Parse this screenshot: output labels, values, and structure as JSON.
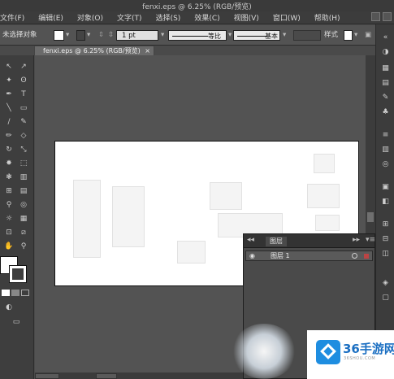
{
  "window": {
    "title": "fenxi.eps @ 6.25% (RGB/预览)"
  },
  "menu": [
    "文件(F)",
    "编辑(E)",
    "对象(O)",
    "文字(T)",
    "选择(S)",
    "效果(C)",
    "视图(V)",
    "窗口(W)",
    "帮助(H)"
  ],
  "control_bar": {
    "selection_label": "未选择对象",
    "stroke_weight": "1 pt",
    "stroke_profile": "等比",
    "brush_profile": "基本",
    "style_label": "样式"
  },
  "document_tab": {
    "label": "fenxi.eps @ 6.25% (RGB/预览)",
    "close": "×"
  },
  "tools": {
    "selection": "↖",
    "direct_selection": "↗",
    "magic_wand": "✦",
    "lasso": "ʘ",
    "pen": "✒",
    "type": "T",
    "line": "╲",
    "rectangle": "▭",
    "paintbrush": "∕",
    "pencil": "✎",
    "blob": "✏",
    "eraser": "◇",
    "rotate": "↻",
    "scale": "⤡",
    "warp": "✸",
    "free_transform": "⬚",
    "symbol_sprayer": "❃",
    "graph": "▥",
    "mesh": "⊞",
    "gradient": "▤",
    "eyedropper": "⚲",
    "blend": "◎",
    "symbol": "☼",
    "column_graph": "▦",
    "artboard": "⊡",
    "slice": "⧄",
    "hand": "✋",
    "zoom": "⚲"
  },
  "layers_panel": {
    "tab_label": "图层",
    "rows": [
      {
        "eye": "◉",
        "name": "图层 1"
      }
    ],
    "collapse": "▸▸",
    "menu": "▾≡"
  },
  "watermark": {
    "brand": "36手游网",
    "url": "36SHOU.COM"
  }
}
